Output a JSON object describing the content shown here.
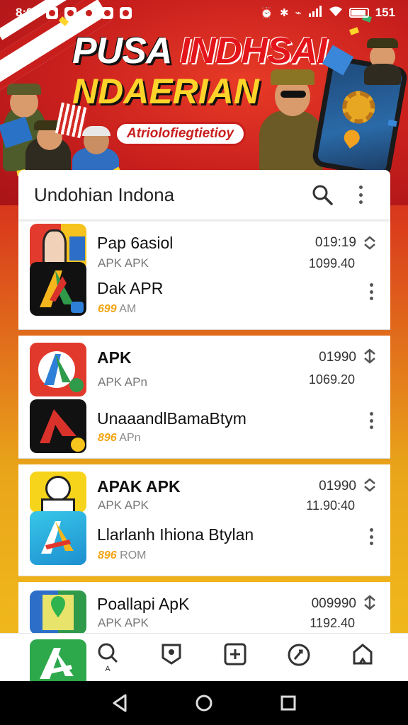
{
  "status_bar": {
    "time": "8:90",
    "right_text": "151",
    "left_icons": [
      "flag-icon",
      "app-icon",
      "app-icon",
      "app-icon",
      "app-icon"
    ],
    "right_icons": [
      "alarm-icon",
      "bluetooth-icon",
      "vibrate-icon",
      "signal-icon",
      "wifi-icon",
      "battery-icon"
    ]
  },
  "banner": {
    "headline_white": "PUSA",
    "headline_red": "INDHSAI",
    "headline_yellow": "NDAERIAN",
    "pill_text": "Atriolofiegtietioy",
    "sash_text": ""
  },
  "search": {
    "title": "Undohian Indona",
    "icons": [
      "search-icon",
      "more-vert-icon"
    ]
  },
  "apps": [
    {
      "name": "Pap 6asiol",
      "subtitle": "APK APK",
      "time": "019:19",
      "size": "1099.40",
      "second_name": "Dak APR",
      "stamp_highlight": "699",
      "stamp_suffix": "AM"
    },
    {
      "name": "APK",
      "subtitle": "APK APn",
      "time": "01990",
      "size": "1069.20",
      "second_name": "UnaaandlBamaBtym",
      "stamp_highlight": "896",
      "stamp_suffix": "APn"
    },
    {
      "name": "APAK APK",
      "subtitle": "APK APK",
      "time": "01990",
      "size": "11.90:40",
      "second_name": "Llarlanh Ihiona Btylan",
      "stamp_highlight": "896",
      "stamp_suffix": "ROM"
    },
    {
      "name": "Poallapi ApK",
      "subtitle": "APK APK",
      "time": "009990",
      "size": "1192.40"
    }
  ],
  "bottom_nav": {
    "items": [
      {
        "icon": "search-icon",
        "label": "A"
      },
      {
        "icon": "badge-icon",
        "label": ""
      },
      {
        "icon": "add-box-icon",
        "label": ""
      },
      {
        "icon": "refresh-icon",
        "label": ""
      },
      {
        "icon": "home-icon",
        "label": ""
      }
    ]
  },
  "system_nav": [
    "back-icon",
    "home-circle-icon",
    "recents-icon"
  ],
  "colors": {
    "brand_red": "#c81f1d",
    "accent_yellow": "#ffd42a",
    "highlight_orange": "#f2a515"
  }
}
